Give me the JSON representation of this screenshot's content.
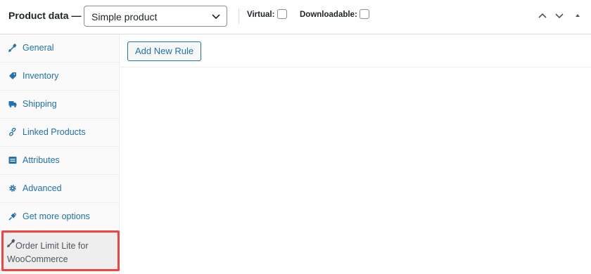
{
  "header": {
    "title": "Product data —",
    "product_type": {
      "selected": "Simple product"
    },
    "virtual_label": "Virtual:",
    "downloadable_label": "Downloadable:",
    "virtual_checked": false,
    "downloadable_checked": false
  },
  "sidebar": {
    "items": [
      {
        "label": "General",
        "icon": "wrench-icon"
      },
      {
        "label": "Inventory",
        "icon": "tag-icon"
      },
      {
        "label": "Shipping",
        "icon": "truck-icon"
      },
      {
        "label": "Linked Products",
        "icon": "link-icon"
      },
      {
        "label": "Attributes",
        "icon": "list-icon"
      },
      {
        "label": "Advanced",
        "icon": "gear-icon"
      },
      {
        "label": "Get more options",
        "icon": "plug-icon"
      },
      {
        "label": "Order Limit Lite for WooCommerce",
        "icon": "wrench-icon",
        "active": true
      }
    ]
  },
  "main": {
    "add_rule_label": "Add New Rule"
  },
  "colors": {
    "link": "#2271b1",
    "highlight": "#ef4444",
    "sidebar_bg": "#fafafa"
  }
}
